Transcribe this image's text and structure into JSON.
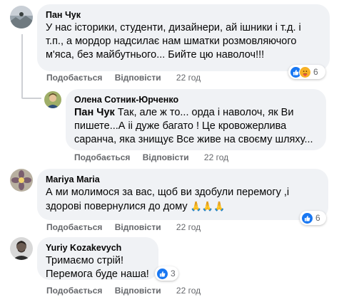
{
  "comments": [
    {
      "author": "Пан Чук",
      "lines": [
        "У нас історики, студенти, дизайнери, ай ішники і т.д. і",
        "т.п., а мордор надсилає нам шматки розмовляючого",
        "м'яса, без майбутнього... Бийте цю наволоч!!!"
      ],
      "like_label": "Подобається",
      "reply_label": "Відповісти",
      "time": "22 год",
      "reaction_count": "6",
      "reactions": [
        "like-icon",
        "care-icon"
      ]
    },
    {
      "author": "Олена Сотник-Юрченко",
      "mention": "Пан Чук",
      "lines": [
        "Так, але ж то... орда і наволоч, як Ви",
        "пишете...А іі дуже багато ! Це кровожерлива",
        "саранча, яка знищує Все живе на своєму шляху..."
      ],
      "like_label": "Подобається",
      "reply_label": "Відповісти",
      "time": "22 год"
    },
    {
      "author": "Mariya Maria",
      "lines": [
        "А ми молимося за вас, щоб ви здобули перемогу ,і",
        "здорові повернулися до дому"
      ],
      "emoji": "🙏🙏🙏",
      "like_label": "Подобається",
      "reply_label": "Відповісти",
      "time": "22 год",
      "reaction_count": "6",
      "reactions": [
        "like-icon"
      ]
    },
    {
      "author": "Yuriy Kozakevych",
      "lines": [
        "Тримаємо стрій!",
        "Перемога буде наша!"
      ],
      "like_label": "Подобається",
      "reply_label": "Відповісти",
      "time": "22 год",
      "reaction_count": "3",
      "reactions": [
        "like-icon"
      ]
    }
  ],
  "colors": {
    "bubble": "#f0f2f5",
    "meta_text": "#65676b",
    "like_blue": "#1877f2",
    "care_yellow": "#f7b125"
  }
}
